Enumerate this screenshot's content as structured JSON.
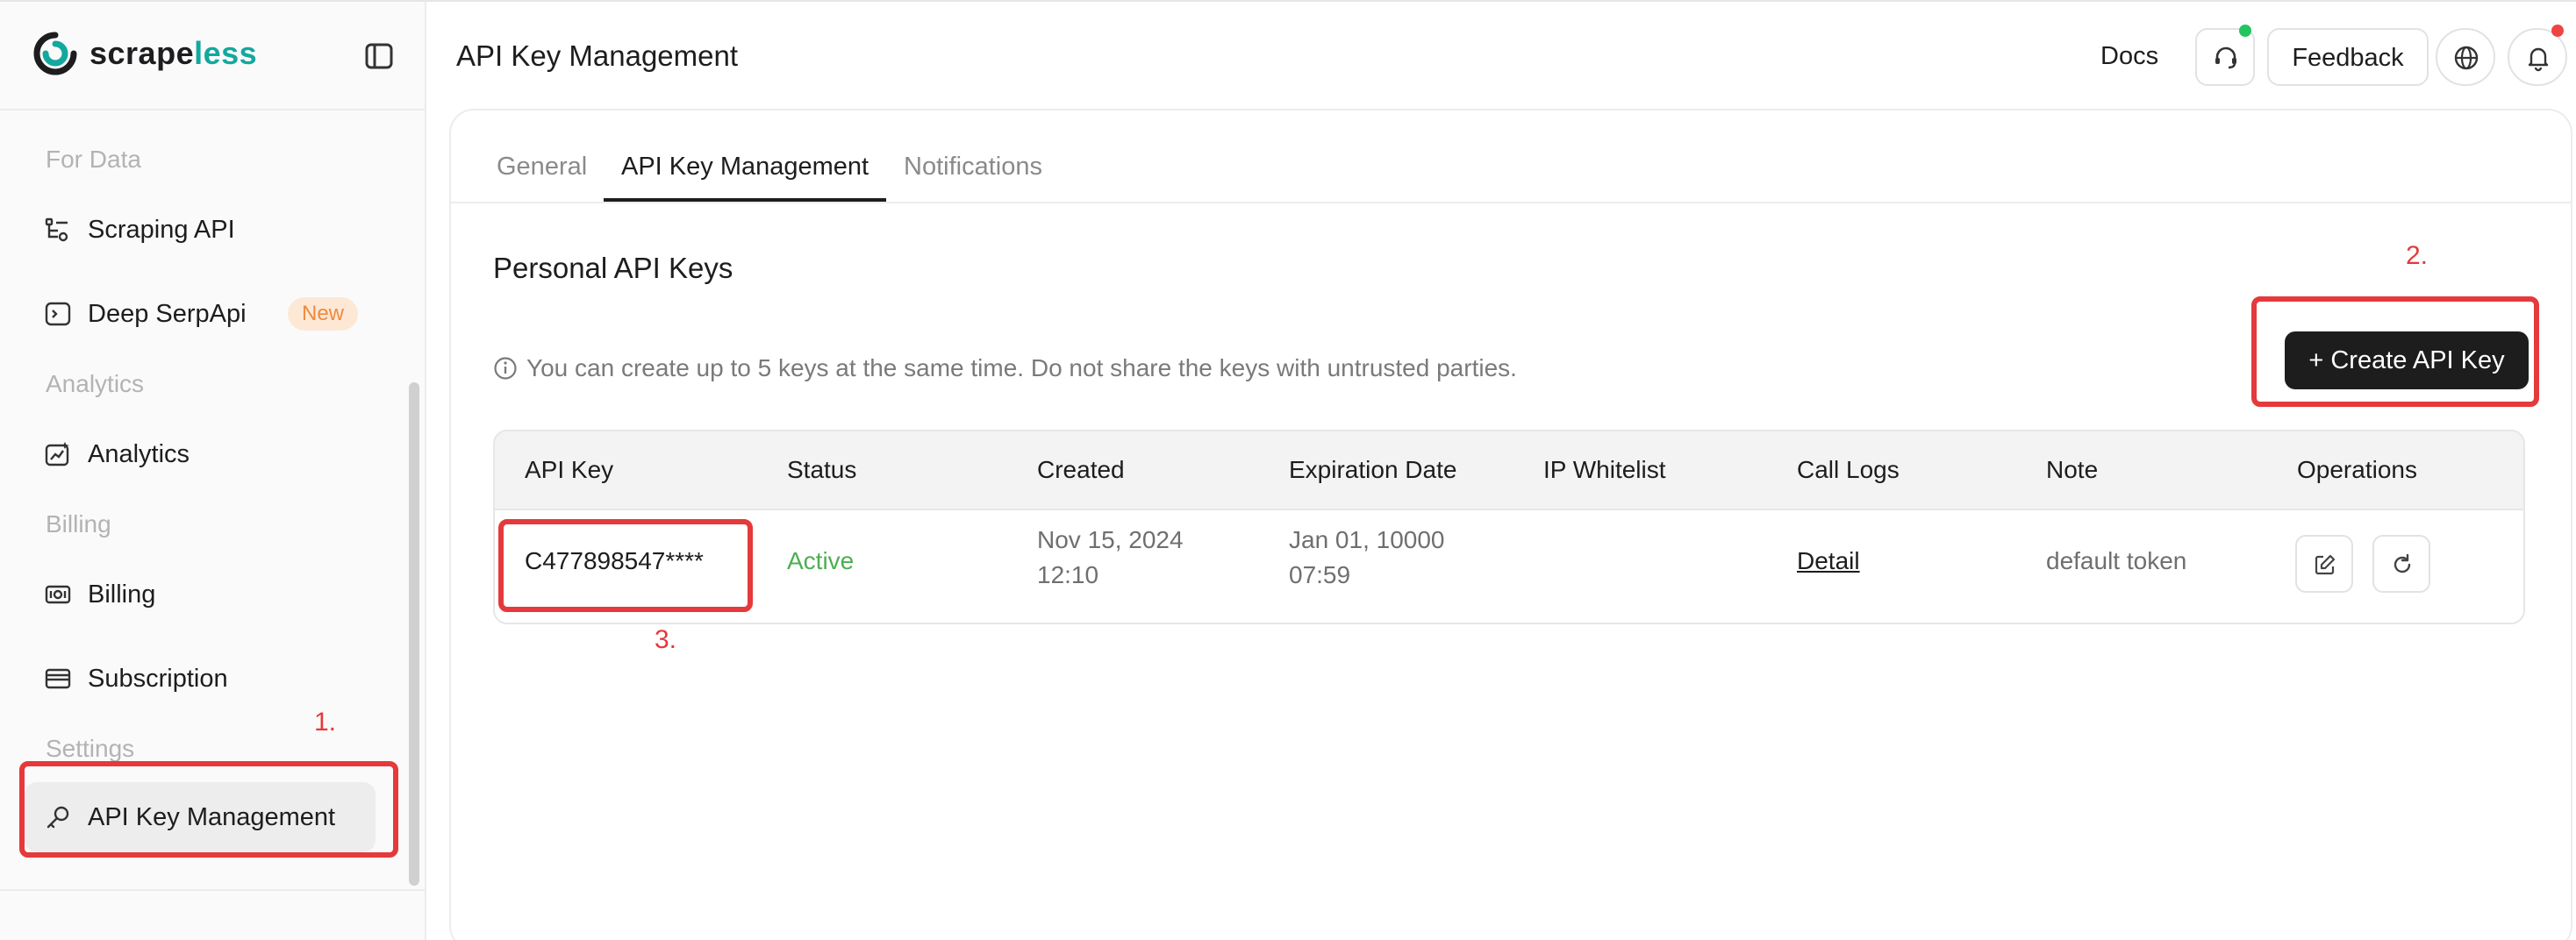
{
  "brand": {
    "prefix": "scrape",
    "suffix": "less"
  },
  "sidebar": {
    "sections": [
      {
        "title": "For Data"
      },
      {
        "title": "Analytics"
      },
      {
        "title": "Billing"
      },
      {
        "title": "Settings"
      }
    ],
    "items": [
      {
        "label": "Scraping API",
        "icon": "scraping-icon"
      },
      {
        "label": "Deep SerpApi",
        "icon": "terminal-icon",
        "badge": "New"
      },
      {
        "label": "Analytics",
        "icon": "analytics-icon"
      },
      {
        "label": "Billing",
        "icon": "billing-icon"
      },
      {
        "label": "Subscription",
        "icon": "card-icon"
      },
      {
        "label": "API Key Management",
        "icon": "key-icon",
        "active": true
      }
    ]
  },
  "header": {
    "title": "API Key Management",
    "docs": "Docs",
    "feedback": "Feedback"
  },
  "tabs": [
    "General",
    "API Key Management",
    "Notifications"
  ],
  "main": {
    "section_title": "Personal API Keys",
    "info": "You can create up to 5 keys at the same time. Do not share the keys with untrusted parties.",
    "create_button": "+ Create API Key"
  },
  "table": {
    "columns": [
      "API Key",
      "Status",
      "Created",
      "Expiration Date",
      "IP Whitelist",
      "Call Logs",
      "Note",
      "Operations"
    ],
    "rows": [
      {
        "api_key": "C477898547****",
        "status": "Active",
        "created_date": "Nov 15, 2024",
        "created_time": "12:10",
        "expiration_date": "Jan 01, 10000",
        "expiration_time": "07:59",
        "ip_whitelist": "",
        "call_logs": "Detail",
        "note": "default token"
      }
    ]
  },
  "annotations": [
    "1.",
    "2.",
    "3."
  ],
  "colors": {
    "accent": "#13a89e",
    "highlight": "#e5393b",
    "active_status": "#4caf50",
    "primary_button": "#1d1d1d"
  }
}
